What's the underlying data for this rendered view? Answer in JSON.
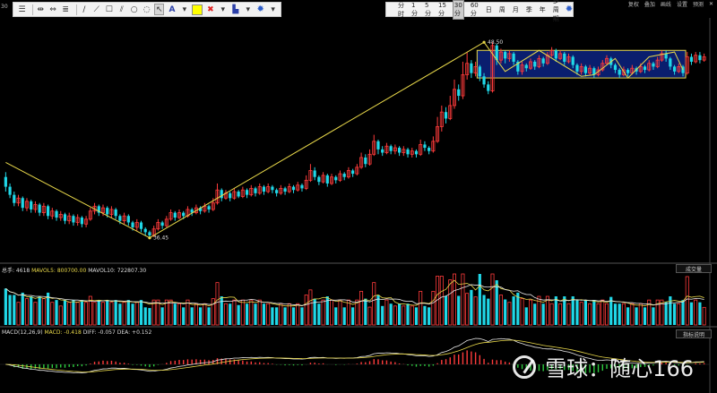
{
  "toolbar_draw": {
    "icons": [
      "menu-icon",
      "horizontal-line-icon",
      "split-icon",
      "list-icon",
      "line-icon",
      "segment-icon",
      "rectangle-icon",
      "parallel-icon",
      "circle-icon",
      "arc-icon",
      "pointer-icon",
      "text-icon",
      "color-swatch",
      "delete-icon",
      "save-icon",
      "settings-icon"
    ],
    "text_label": "A",
    "color": "#ffff00"
  },
  "toolbar_period": {
    "items": [
      "分时",
      "1分",
      "5分",
      "15分",
      "30分",
      "60分",
      "日",
      "周",
      "月",
      "季",
      "年",
      "多周期"
    ],
    "active": "30分"
  },
  "topright": {
    "items": [
      "复权",
      "叠加",
      "画线",
      "设置",
      "预测"
    ],
    "close": "✕"
  },
  "price_panel": {
    "corner_label": "30",
    "annotation_high": "48.50",
    "annotation_low": "36.45"
  },
  "volume_panel": {
    "label_total": "总手: 4618",
    "label_ma5": "MAVOL5: 800700.00",
    "label_ma10": "MAVOL10: 722807.30",
    "selector": "成交量"
  },
  "macd_panel": {
    "label_name": "MACD(12,26,9)",
    "label_macd": "MACD: -0.418",
    "label_diff": "DIFF: -0.057",
    "label_dea": "DEA: +0.152",
    "selector": "指标说明"
  },
  "watermark": {
    "text": "雪球：随心166"
  },
  "colors": {
    "up": "#ff3b3b",
    "down": "#20d8e8",
    "line": "#e8d84a",
    "box": "#e8d84a",
    "box_fill": "#0a1e6e",
    "ma_white": "#e8e8e8",
    "ma_yellow": "#e8d84a"
  },
  "chart_data": {
    "type": "candlestick",
    "price_range": [
      35,
      50
    ],
    "annotations": [
      {
        "label": "48.50",
        "price": 48.5,
        "bar": 113
      },
      {
        "label": "36.45",
        "price": 36.45,
        "bar": 34
      }
    ],
    "candles": [
      [
        40.2,
        39.6,
        40.5,
        39.3
      ],
      [
        39.6,
        39.1,
        39.8,
        38.9
      ],
      [
        39.1,
        38.6,
        39.3,
        38.4
      ],
      [
        38.6,
        38.9,
        39.1,
        38.4
      ],
      [
        38.9,
        38.3,
        39.0,
        38.1
      ],
      [
        38.3,
        38.7,
        38.9,
        38.1
      ],
      [
        38.7,
        38.2,
        38.8,
        38.0
      ],
      [
        38.2,
        38.5,
        38.7,
        38.0
      ],
      [
        38.5,
        38.0,
        38.6,
        37.8
      ],
      [
        38.0,
        38.4,
        38.6,
        37.8
      ],
      [
        38.4,
        37.8,
        38.5,
        37.6
      ],
      [
        37.8,
        38.1,
        38.3,
        37.6
      ],
      [
        38.1,
        37.7,
        38.2,
        37.5
      ],
      [
        37.7,
        37.9,
        38.1,
        37.5
      ],
      [
        37.9,
        37.5,
        38.0,
        37.3
      ],
      [
        37.5,
        37.8,
        38.0,
        37.3
      ],
      [
        37.8,
        37.4,
        37.9,
        37.2
      ],
      [
        37.4,
        37.7,
        37.9,
        37.2
      ],
      [
        37.7,
        37.3,
        37.8,
        37.1
      ],
      [
        37.3,
        37.6,
        37.8,
        37.1
      ],
      [
        37.6,
        38.1,
        38.3,
        37.5
      ],
      [
        38.1,
        38.4,
        38.6,
        37.9
      ],
      [
        38.4,
        38.0,
        38.5,
        37.8
      ],
      [
        38.0,
        38.3,
        38.5,
        37.8
      ],
      [
        38.3,
        37.9,
        38.4,
        37.7
      ],
      [
        37.9,
        38.2,
        38.4,
        37.7
      ],
      [
        38.2,
        37.8,
        38.3,
        37.6
      ],
      [
        37.8,
        37.5,
        37.9,
        37.3
      ],
      [
        37.5,
        37.8,
        38.0,
        37.3
      ],
      [
        37.8,
        37.4,
        37.9,
        37.2
      ],
      [
        37.4,
        37.1,
        37.5,
        36.9
      ],
      [
        37.1,
        37.4,
        37.6,
        36.9
      ],
      [
        37.4,
        37.0,
        37.5,
        36.8
      ],
      [
        37.0,
        36.8,
        37.1,
        36.6
      ],
      [
        36.8,
        36.6,
        36.9,
        36.45
      ],
      [
        36.6,
        37.0,
        37.2,
        36.5
      ],
      [
        37.0,
        37.4,
        37.6,
        36.9
      ],
      [
        37.4,
        37.2,
        37.5,
        37.0
      ],
      [
        37.2,
        37.6,
        37.8,
        37.1
      ],
      [
        37.6,
        38.0,
        38.2,
        37.5
      ],
      [
        38.0,
        37.7,
        38.1,
        37.5
      ],
      [
        37.7,
        38.0,
        38.2,
        37.6
      ],
      [
        38.0,
        37.8,
        38.1,
        37.6
      ],
      [
        37.8,
        38.2,
        38.4,
        37.7
      ],
      [
        38.2,
        38.0,
        38.3,
        37.8
      ],
      [
        38.0,
        38.3,
        38.5,
        37.9
      ],
      [
        38.3,
        38.1,
        38.4,
        37.9
      ],
      [
        38.1,
        38.4,
        38.6,
        38.0
      ],
      [
        38.4,
        38.2,
        38.5,
        38.0
      ],
      [
        38.2,
        38.6,
        38.9,
        38.1
      ],
      [
        38.6,
        39.4,
        39.8,
        38.5
      ],
      [
        39.4,
        38.9,
        39.5,
        38.7
      ],
      [
        38.9,
        39.2,
        39.4,
        38.8
      ],
      [
        39.2,
        38.9,
        39.3,
        38.7
      ],
      [
        38.9,
        39.3,
        39.5,
        38.8
      ],
      [
        39.3,
        39.0,
        39.4,
        38.9
      ],
      [
        39.0,
        39.4,
        39.6,
        38.9
      ],
      [
        39.4,
        39.1,
        39.5,
        38.9
      ],
      [
        39.1,
        39.5,
        39.7,
        39.0
      ],
      [
        39.5,
        39.2,
        39.6,
        39.0
      ],
      [
        39.2,
        39.6,
        39.8,
        39.1
      ],
      [
        39.6,
        39.3,
        39.7,
        39.1
      ],
      [
        39.3,
        39.6,
        39.8,
        39.2
      ],
      [
        39.6,
        39.4,
        39.7,
        39.2
      ],
      [
        39.4,
        39.2,
        39.5,
        39.0
      ],
      [
        39.2,
        39.5,
        39.7,
        39.1
      ],
      [
        39.5,
        39.3,
        39.6,
        39.1
      ],
      [
        39.3,
        39.6,
        39.8,
        39.2
      ],
      [
        39.6,
        39.4,
        39.7,
        39.2
      ],
      [
        39.4,
        39.7,
        39.9,
        39.3
      ],
      [
        39.7,
        39.5,
        39.8,
        39.3
      ],
      [
        39.5,
        40.0,
        40.3,
        39.4
      ],
      [
        40.0,
        40.6,
        41.0,
        39.9
      ],
      [
        40.6,
        40.2,
        40.8,
        40.0
      ],
      [
        40.2,
        39.9,
        40.3,
        39.7
      ],
      [
        39.9,
        40.3,
        40.5,
        39.8
      ],
      [
        40.3,
        39.8,
        40.4,
        39.6
      ],
      [
        39.8,
        40.2,
        40.4,
        39.7
      ],
      [
        40.2,
        40.0,
        40.3,
        39.8
      ],
      [
        40.0,
        40.4,
        40.6,
        39.9
      ],
      [
        40.4,
        40.2,
        40.5,
        40.0
      ],
      [
        40.2,
        40.6,
        40.8,
        40.1
      ],
      [
        40.6,
        40.4,
        40.7,
        40.2
      ],
      [
        40.4,
        40.8,
        41.0,
        40.3
      ],
      [
        40.8,
        41.4,
        41.7,
        40.7
      ],
      [
        41.4,
        41.0,
        41.6,
        40.8
      ],
      [
        41.0,
        41.6,
        41.9,
        40.9
      ],
      [
        41.6,
        42.4,
        42.8,
        41.5
      ],
      [
        42.4,
        41.9,
        42.5,
        41.6
      ],
      [
        41.9,
        41.7,
        42.1,
        41.5
      ],
      [
        41.7,
        42.1,
        42.3,
        41.6
      ],
      [
        42.1,
        41.8,
        42.2,
        41.6
      ],
      [
        41.8,
        42.0,
        42.2,
        41.6
      ],
      [
        42.0,
        41.7,
        42.1,
        41.5
      ],
      [
        41.7,
        41.9,
        42.1,
        41.5
      ],
      [
        41.9,
        41.6,
        42.0,
        41.4
      ],
      [
        41.6,
        41.8,
        42.0,
        41.4
      ],
      [
        41.8,
        41.6,
        41.9,
        41.4
      ],
      [
        41.6,
        42.2,
        42.5,
        41.5
      ],
      [
        42.2,
        42.0,
        42.4,
        41.8
      ],
      [
        42.0,
        41.8,
        42.1,
        41.6
      ],
      [
        41.8,
        42.4,
        42.7,
        41.7
      ],
      [
        42.4,
        43.3,
        43.9,
        42.3
      ],
      [
        43.3,
        44.2,
        44.6,
        43.0
      ],
      [
        44.2,
        43.8,
        44.5,
        43.5
      ],
      [
        43.8,
        44.6,
        45.2,
        43.7
      ],
      [
        44.6,
        45.6,
        46.2,
        44.4
      ],
      [
        45.6,
        45.2,
        45.9,
        44.9
      ],
      [
        45.2,
        46.5,
        47.3,
        45.0
      ],
      [
        46.5,
        47.2,
        47.9,
        46.2
      ],
      [
        47.2,
        46.6,
        47.4,
        46.3
      ],
      [
        46.6,
        47.0,
        47.3,
        46.4
      ],
      [
        47.0,
        46.4,
        47.1,
        46.1
      ],
      [
        46.4,
        45.9,
        46.6,
        45.7
      ],
      [
        45.9,
        45.5,
        46.1,
        45.3
      ],
      [
        45.5,
        48.3,
        48.5,
        45.4
      ],
      [
        48.3,
        47.4,
        48.4,
        47.1
      ],
      [
        47.4,
        47.9,
        48.1,
        47.2
      ],
      [
        47.9,
        47.5,
        48.0,
        47.2
      ],
      [
        47.5,
        47.8,
        48.0,
        47.3
      ],
      [
        47.8,
        47.3,
        47.9,
        47.1
      ],
      [
        47.3,
        46.7,
        47.4,
        46.5
      ],
      [
        46.7,
        47.1,
        47.3,
        46.5
      ],
      [
        47.1,
        46.9,
        47.2,
        46.7
      ],
      [
        46.9,
        47.3,
        47.5,
        46.8
      ],
      [
        47.3,
        47.0,
        47.4,
        46.8
      ],
      [
        47.0,
        47.5,
        47.7,
        46.9
      ],
      [
        47.5,
        47.2,
        47.6,
        47.0
      ],
      [
        47.2,
        47.7,
        47.9,
        47.1
      ],
      [
        47.7,
        48.0,
        48.2,
        47.6
      ],
      [
        48.0,
        47.5,
        48.1,
        47.3
      ],
      [
        47.5,
        47.8,
        48.0,
        47.4
      ],
      [
        47.8,
        47.3,
        47.9,
        47.1
      ],
      [
        47.3,
        47.6,
        47.8,
        47.2
      ],
      [
        47.6,
        47.1,
        47.7,
        46.9
      ],
      [
        47.1,
        46.7,
        47.2,
        46.5
      ],
      [
        46.7,
        47.0,
        47.2,
        46.5
      ],
      [
        47.0,
        46.6,
        47.1,
        46.4
      ],
      [
        46.6,
        46.9,
        47.1,
        46.5
      ],
      [
        46.9,
        46.5,
        47.0,
        46.3
      ],
      [
        46.5,
        46.8,
        47.0,
        46.4
      ],
      [
        46.8,
        47.2,
        47.4,
        46.7
      ],
      [
        47.2,
        47.5,
        47.7,
        47.1
      ],
      [
        47.5,
        47.1,
        47.6,
        46.9
      ],
      [
        47.1,
        46.8,
        47.2,
        46.6
      ],
      [
        46.8,
        46.5,
        46.9,
        46.3
      ],
      [
        46.5,
        46.8,
        47.0,
        46.4
      ],
      [
        46.8,
        46.6,
        46.9,
        46.4
      ],
      [
        46.6,
        46.9,
        47.1,
        46.5
      ],
      [
        46.9,
        46.7,
        47.0,
        46.5
      ],
      [
        46.7,
        47.0,
        47.2,
        46.6
      ],
      [
        47.0,
        46.8,
        47.1,
        46.6
      ],
      [
        46.8,
        47.2,
        47.4,
        46.7
      ],
      [
        47.2,
        47.0,
        47.3,
        46.8
      ],
      [
        47.0,
        47.4,
        47.6,
        46.9
      ],
      [
        47.4,
        47.8,
        48.0,
        47.3
      ],
      [
        47.8,
        47.5,
        48.0,
        47.3
      ],
      [
        47.5,
        47.0,
        47.6,
        46.8
      ],
      [
        47.0,
        46.7,
        47.1,
        46.5
      ],
      [
        46.7,
        47.0,
        47.2,
        46.6
      ],
      [
        47.0,
        46.6,
        47.1,
        46.4
      ],
      [
        46.6,
        47.6,
        47.9,
        46.5
      ],
      [
        47.6,
        47.3,
        47.8,
        47.1
      ],
      [
        47.3,
        47.7,
        47.9,
        47.2
      ],
      [
        47.7,
        47.4,
        47.9,
        47.2
      ],
      [
        47.4,
        47.6,
        47.8,
        47.3
      ]
    ],
    "pattern_box": {
      "from_bar": 112,
      "to_bar": 160,
      "high": 48.0,
      "low": 46.3
    }
  }
}
